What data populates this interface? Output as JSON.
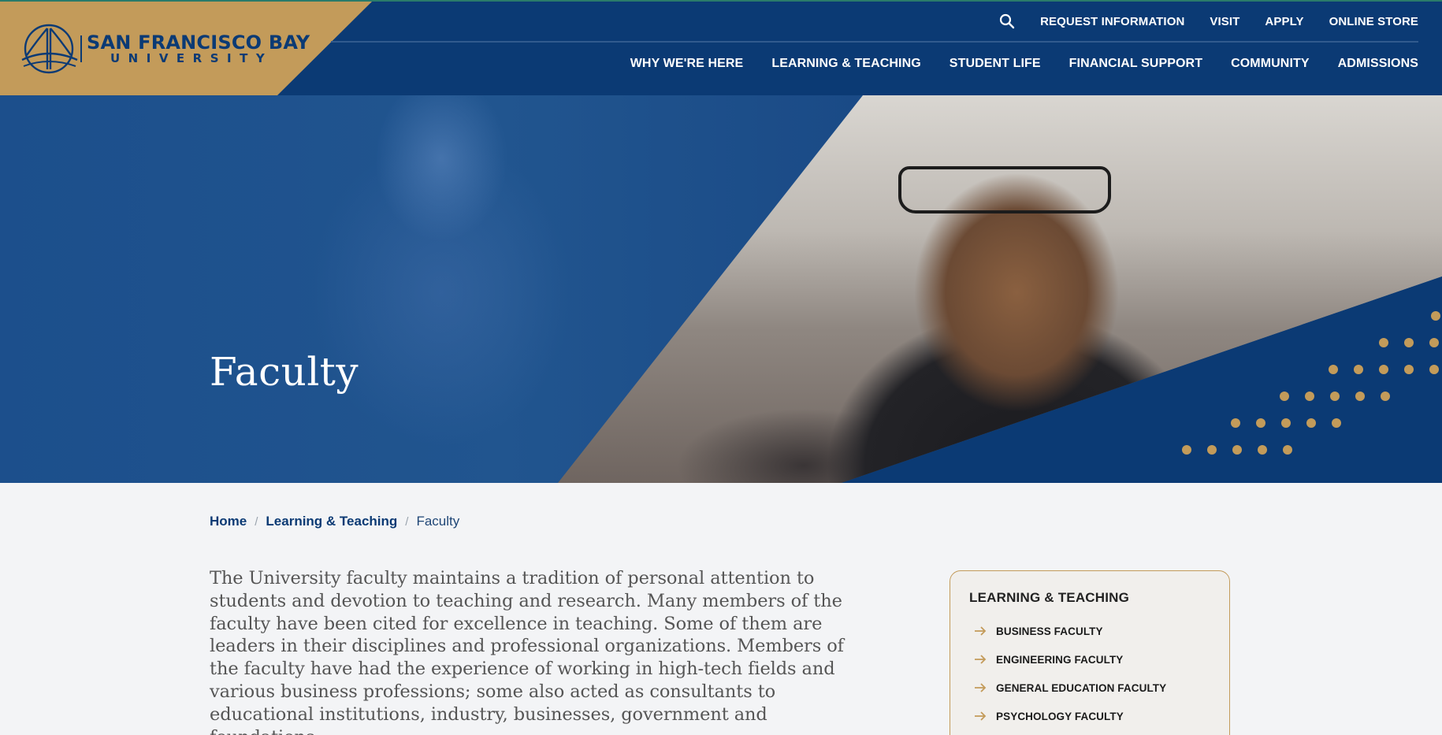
{
  "brand": {
    "name_line1": "SAN FRANCISCO BAY",
    "name_line2": "UNIVERSITY",
    "colors": {
      "navy": "#0b3a74",
      "gold": "#c39b5a",
      "page_bg": "#f3f4f6"
    }
  },
  "utility_nav": {
    "search_icon": "search-icon",
    "items": [
      "REQUEST INFORMATION",
      "VISIT",
      "APPLY",
      "ONLINE STORE"
    ]
  },
  "main_nav": {
    "items": [
      "WHY WE'RE HERE",
      "LEARNING & TEACHING",
      "STUDENT LIFE",
      "FINANCIAL SUPPORT",
      "COMMUNITY",
      "ADMISSIONS"
    ]
  },
  "hero": {
    "title": "Faculty"
  },
  "breadcrumb": {
    "items": [
      "Home",
      "Learning & Teaching"
    ],
    "current": "Faculty",
    "separator": "/"
  },
  "intro": {
    "text": "The University faculty maintains a tradition of personal attention to students and devotion to teaching and research. Many members of the faculty have been cited for excellence in teaching. Some of them are leaders in their disciplines and professional organizations. Members of the faculty have had the experience of working in high-tech fields and various business professions; some also acted as consultants to educational institutions, industry, businesses, government and foundations."
  },
  "sidebar": {
    "title": "LEARNING & TEACHING",
    "item_icon": "arrow-right-icon",
    "items": [
      "BUSINESS FACULTY",
      "ENGINEERING FACULTY",
      "GENERAL EDUCATION FACULTY",
      "PSYCHOLOGY FACULTY"
    ]
  }
}
